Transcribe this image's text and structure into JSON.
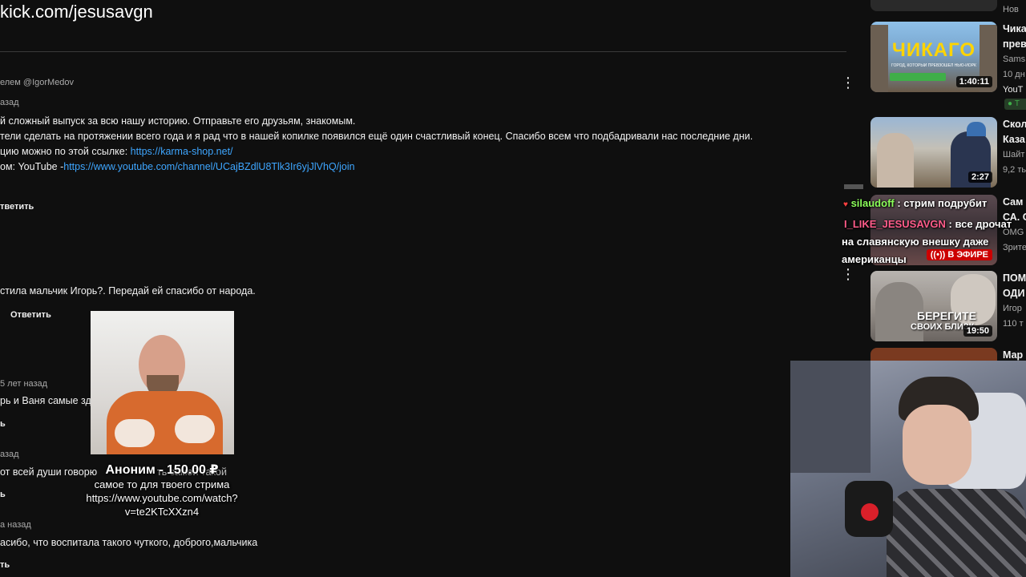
{
  "url_overlay": "kick.com/jesusavgn",
  "comments": {
    "c1": {
      "author": "елем @IgorMedov",
      "time": "азад",
      "lines": [
        "й сложный выпуск за всю нашу историю. Отправьте его друзьям, знакомым.",
        "тели сделать на протяжении всего года и я рад что в нашей копилке появился ещё один счастливый конец. Спасибо всем что подбадривали нас последние дни.",
        "цию можно по этой ссылке: ",
        "ом: YouTube -"
      ],
      "link1": "https://karma-shop.net/",
      "link2": "https://www.youtube.com/channel/UCajBZdlU8Tlk3Ir6yjJlVhQ/join",
      "reply": "тветить"
    },
    "c2": {
      "text": "стила мальчик Игорь?. Передай ей спасибо от народа.",
      "reply": "Ответить"
    },
    "c3": {
      "time": "5 лет назад",
      "text": "рь и Ваня самые зд",
      "reply": "ь"
    },
    "c4": {
      "time": "азад",
      "text": "от всей души говорю",
      "extra": "ть самой такой",
      "reply": "ь"
    },
    "c5": {
      "time": "а назад",
      "text": "асибо, что воспитала такого чуткого, доброго,мальчика",
      "reply": "ть"
    }
  },
  "donation": {
    "header": "Аноним - 150.00 ₽",
    "message_lines": [
      "самое то для твоего стрима",
      "https://www.youtube.com/watch?",
      "v=te2KTcXXzn4"
    ]
  },
  "sidebar": {
    "top_meta": "Нов",
    "items": [
      {
        "thumb_text": "ЧИКАГО",
        "thumb_sub": "ГОРОД, КОТОРЫЙ ПРЕВЗОШЁЛ НЬЮ-ЙОРК",
        "duration": "1:40:11",
        "title_lines": [
          "Чика",
          "прев"
        ],
        "meta_lines": [
          "Sams",
          "10 дн",
          "YouT"
        ],
        "badge": "Т"
      },
      {
        "duration": "2:27",
        "title_lines": [
          "Скол",
          "Каза"
        ],
        "meta_lines": [
          "Шайт",
          "9,2 ть"
        ]
      },
      {
        "live_badge": "В ЭФИРЕ",
        "title_lines": [
          "Сам",
          "СА. С"
        ],
        "meta_lines": [
          "OMG",
          "Зрите"
        ]
      },
      {
        "thumb_text": "БЕРЕГИТЕ",
        "thumb_sub": "СВОИХ БЛИЗК",
        "duration": "19:50",
        "title_lines": [
          "ПОМ",
          "ОДИ"
        ],
        "meta_lines": [
          "Игор",
          "110 т"
        ]
      },
      {
        "title_lines": [
          "Мар"
        ]
      }
    ]
  },
  "chat": {
    "messages": [
      {
        "user": "silaudoff",
        "user_color": "#8cff5a",
        "text": " : стрим подрубит"
      },
      {
        "user": "I_LIKE_JESUSAVGN",
        "user_color": "#ff5c8a",
        "text": " : все дрочат"
      }
    ],
    "continuation": [
      "на славянскую внешку даже",
      "американцы"
    ]
  },
  "colors": {
    "background": "#0f0f0f",
    "link": "#3ea6ff",
    "live": "#cc0000"
  }
}
